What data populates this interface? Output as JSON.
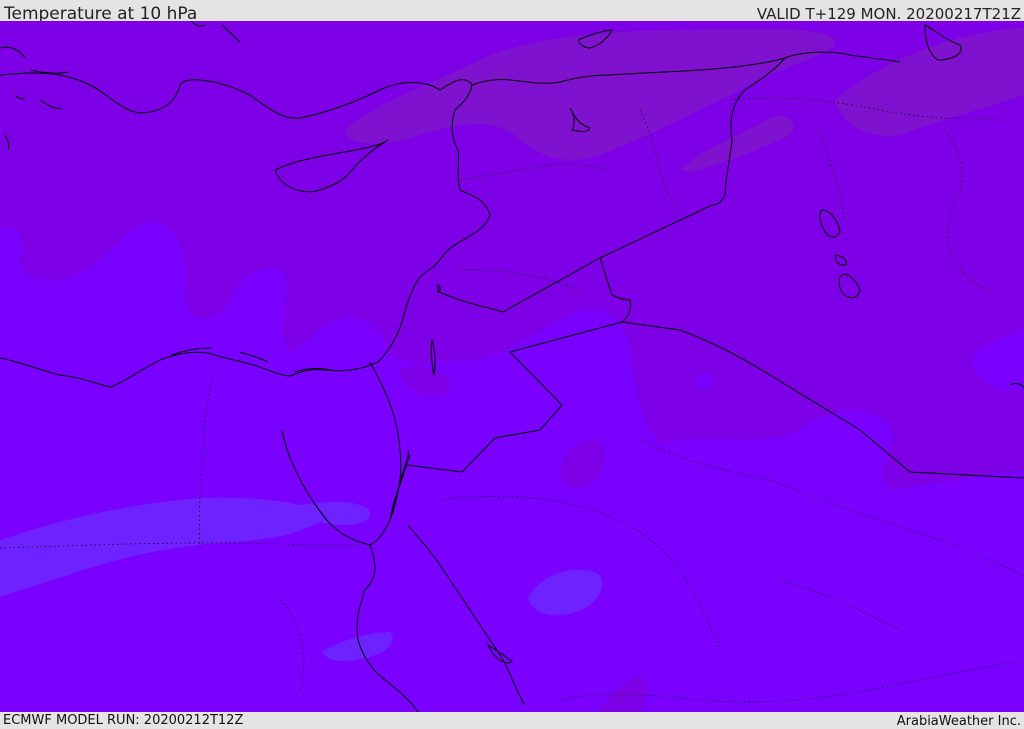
{
  "header": {
    "title": "Temperature at 10 hPa",
    "valid_time": "VALID T+129 MON. 20200217T21Z"
  },
  "footer": {
    "model_run": "ECMWF MODEL RUN: 20200212T12Z",
    "brand": "ArabiaWeather Inc."
  },
  "colors": {
    "field_base": "#7a00ff",
    "field_cold_band": "#7d00e6",
    "field_warm_patch": "#7e12cf",
    "field_light_patch": "#6e22ff",
    "coastline": "#000000"
  }
}
